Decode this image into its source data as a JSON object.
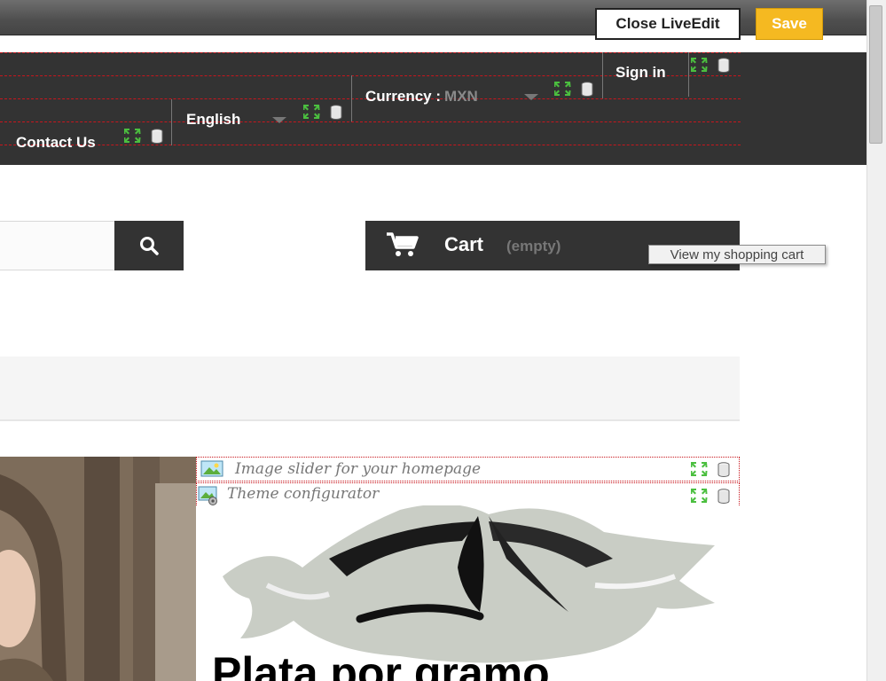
{
  "liveedit": {
    "close_label": "Close LiveEdit",
    "save_label": "Save",
    "save_color": "#f5b921"
  },
  "nav": {
    "sign_in": "Sign in",
    "currency_label": "Currency :",
    "currency_value": "MXN",
    "language": "English",
    "contact": "Contact Us"
  },
  "search": {
    "placeholder": "",
    "button_icon": "search-icon"
  },
  "cart": {
    "label": "Cart",
    "status": "(empty)",
    "icon": "cart-icon",
    "tooltip": "View my shopping cart"
  },
  "modules": [
    {
      "label": "Image slider for your homepage",
      "icon": "image-slider-icon"
    },
    {
      "label": "Theme configurator",
      "icon": "theme-configurator-icon"
    }
  ],
  "banner": {
    "title": "Plata por gramo"
  },
  "colors": {
    "nav_bg": "#333333",
    "module_border": "#c8161d"
  }
}
